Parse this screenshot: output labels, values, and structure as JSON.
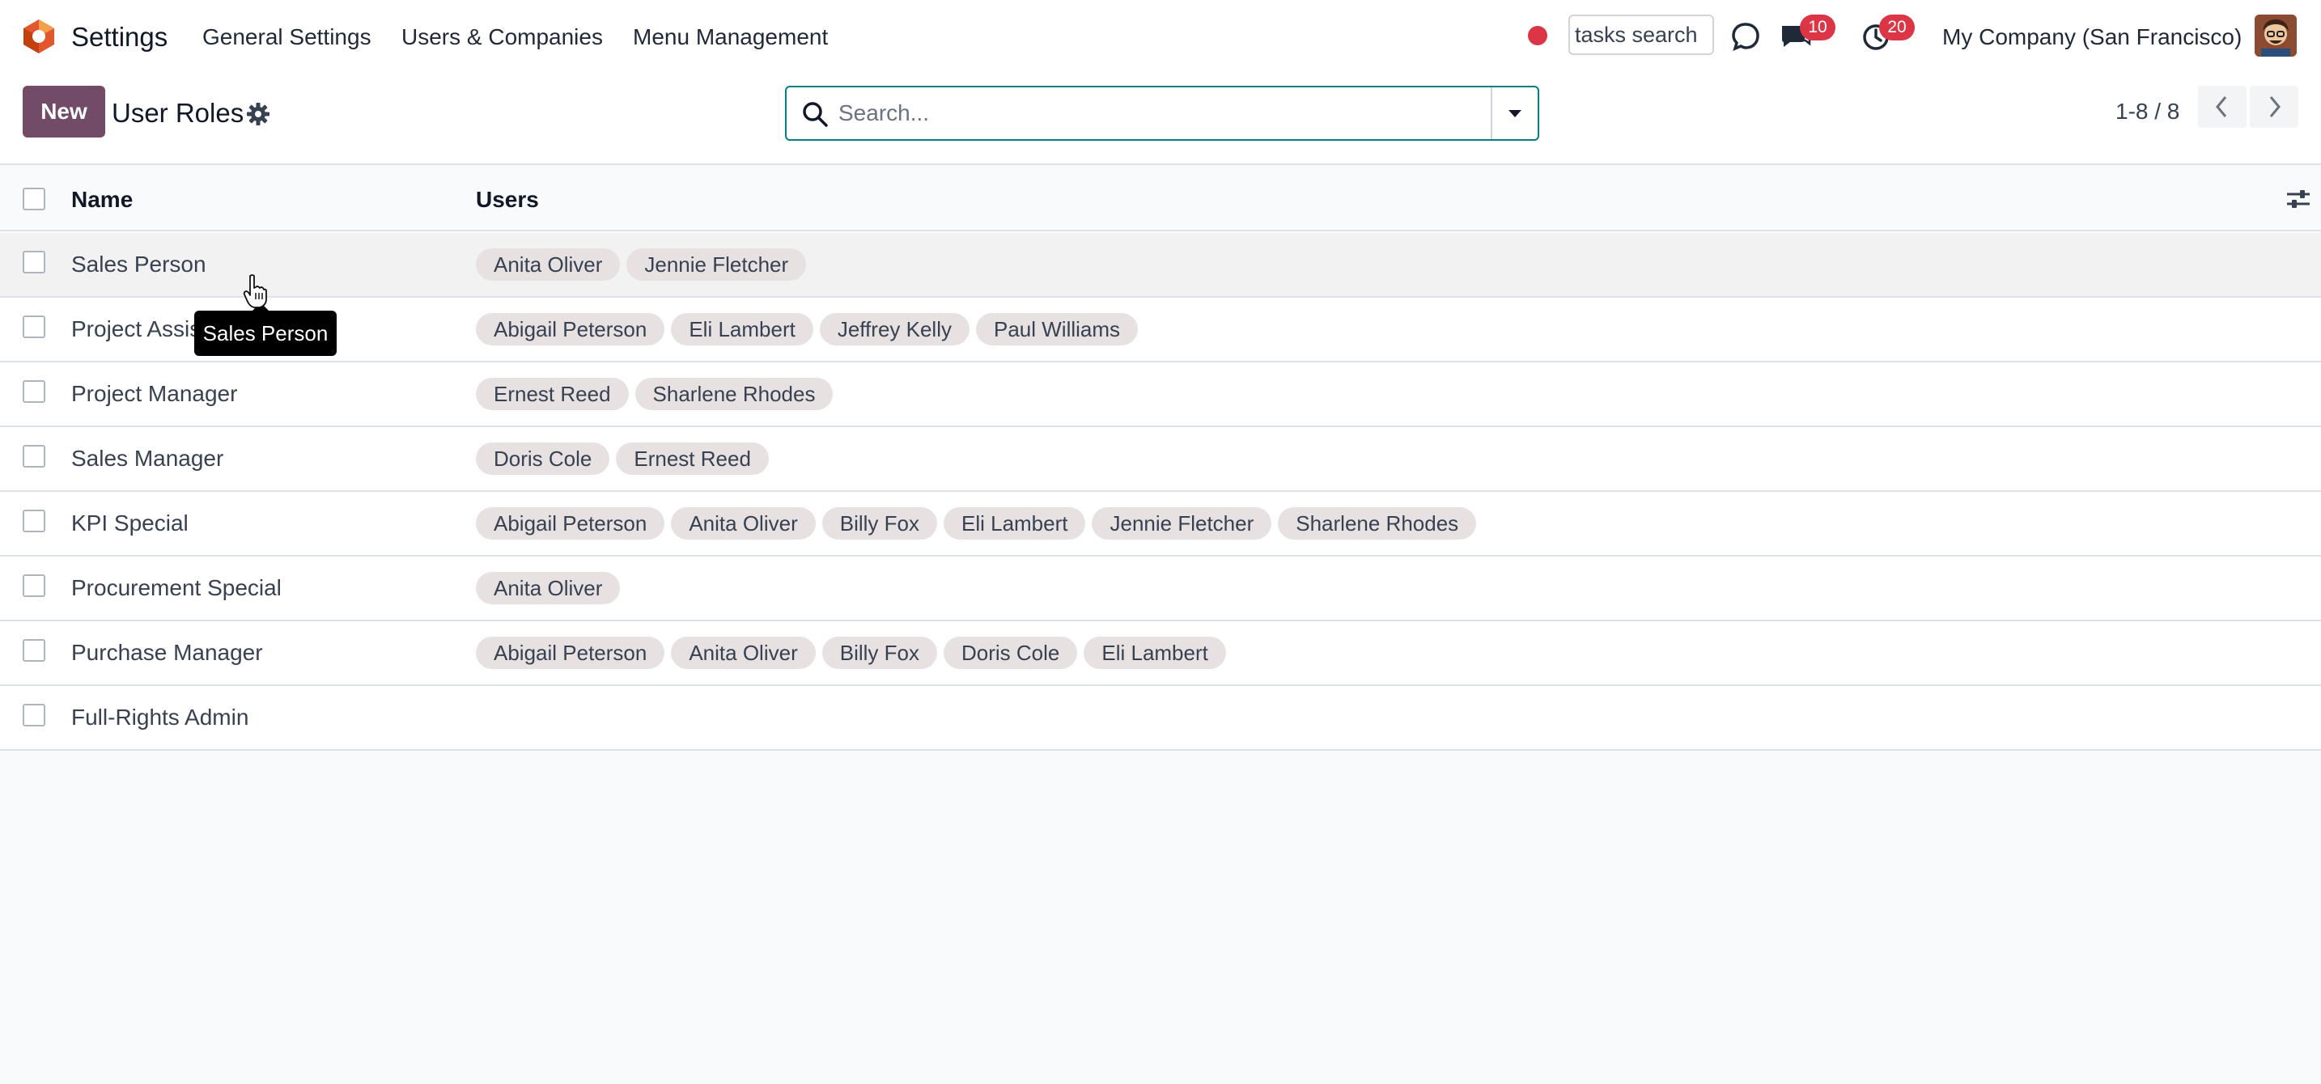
{
  "navbar": {
    "app_name": "Settings",
    "menu": [
      "General Settings",
      "Users & Companies",
      "Menu Management"
    ],
    "tasks_search_value": "tasks search",
    "messages_count": "10",
    "activities_count": "20",
    "company": "My Company (San Francisco)"
  },
  "control": {
    "new_label": "New",
    "title": "User Roles",
    "search_placeholder": "Search...",
    "pager": "1-8 / 8"
  },
  "list": {
    "columns": [
      "Name",
      "Users"
    ],
    "rows": [
      {
        "name": "Sales Person",
        "users": [
          "Anita Oliver",
          "Jennie Fletcher"
        ]
      },
      {
        "name": "Project Assistant",
        "users": [
          "Abigail Peterson",
          "Eli Lambert",
          "Jeffrey Kelly",
          "Paul Williams"
        ]
      },
      {
        "name": "Project Manager",
        "users": [
          "Ernest Reed",
          "Sharlene Rhodes"
        ]
      },
      {
        "name": "Sales Manager",
        "users": [
          "Doris Cole",
          "Ernest Reed"
        ]
      },
      {
        "name": "KPI Special",
        "users": [
          "Abigail Peterson",
          "Anita Oliver",
          "Billy Fox",
          "Eli Lambert",
          "Jennie Fletcher",
          "Sharlene Rhodes"
        ]
      },
      {
        "name": "Procurement Special",
        "users": [
          "Anita Oliver"
        ]
      },
      {
        "name": "Purchase Manager",
        "users": [
          "Abigail Peterson",
          "Anita Oliver",
          "Billy Fox",
          "Doris Cole",
          "Eli Lambert"
        ]
      },
      {
        "name": "Full-Rights Admin",
        "users": []
      }
    ]
  },
  "tooltip": "Sales Person",
  "colors": {
    "brand": "#714b67",
    "focus": "#017e84",
    "badge": "#dc3545",
    "tag": "#e7e1e1"
  }
}
